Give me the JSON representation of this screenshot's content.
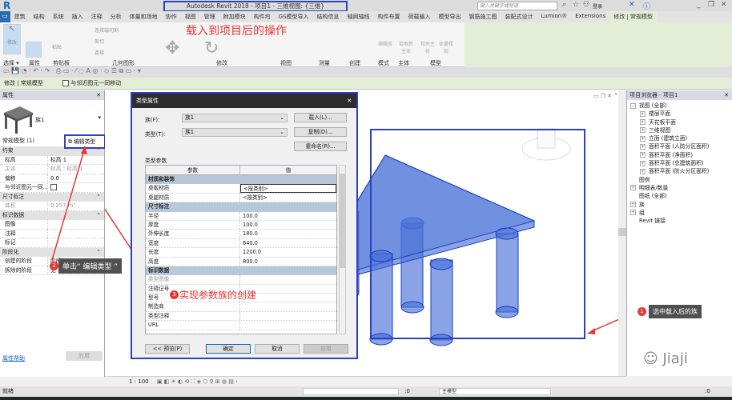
{
  "window": {
    "title": "Autodesk Revit 2018 -    项目1 - 三维视图: {三维}",
    "search_placeholder": "键入关键字或短语",
    "login": "登录"
  },
  "tabs": [
    "建筑",
    "结构",
    "系统",
    "插入",
    "注释",
    "分析",
    "体量和场地",
    "协作",
    "视图",
    "管理",
    "附加模块",
    "构件坞",
    "GS模型导入",
    "结构信息",
    "轴网轴线",
    "构件布置",
    "荷载输入",
    "模型导出",
    "钢筋施工图",
    "装配式设计",
    "Lumion®",
    "Extensions",
    "修改 | 常规模型"
  ],
  "active_tab": "修改 | 常规模型",
  "ribbon": {
    "modify_label": "修改",
    "paste_label": "粘贴",
    "join_label": "连接端切割",
    "cut_label": "剪切",
    "connect_label": "连接",
    "panels": [
      "选择 ▾",
      "属性",
      "剪贴板",
      "几何图形",
      "修改",
      "视图",
      "测量",
      "创建",
      "模式",
      "主体",
      "模型"
    ],
    "edit_family": "编辑族",
    "pick_host": "拾取新主体",
    "related_host": "相关主体",
    "mass_floors": "体量楼层"
  },
  "annotation_top": "载入到项目后的操作",
  "options_bar": {
    "context": "修改 | 常规模型",
    "checkbox_label": "与邻近图元一同移动",
    "checked": false
  },
  "properties": {
    "header": "属性",
    "family_name": "族1",
    "type_selector": "常规模型 (1)",
    "edit_type": "编辑类型",
    "groups": [
      {
        "name": "约束",
        "rows": [
          {
            "k": "标高",
            "v": "标高 1"
          },
          {
            "k": "主体",
            "v": "标高 : 标高 1",
            "disabled": true
          },
          {
            "k": "偏移",
            "v": "0.0"
          },
          {
            "k": "与邻近图元一同...",
            "v": "",
            "checkbox": true
          }
        ]
      },
      {
        "name": "尺寸标注",
        "rows": [
          {
            "k": "体积",
            "v": "0.257 m³",
            "disabled": true
          }
        ]
      },
      {
        "name": "标识数据",
        "rows": [
          {
            "k": "图像",
            "v": ""
          },
          {
            "k": "注释",
            "v": ""
          },
          {
            "k": "标记",
            "v": ""
          }
        ]
      },
      {
        "name": "阶段化",
        "rows": [
          {
            "k": "创建的阶段",
            "v": "阶段 1"
          },
          {
            "k": "拆除的阶段",
            "v": "无"
          }
        ]
      }
    ],
    "help_link": "属性帮助",
    "apply": "应用"
  },
  "callouts": {
    "c1": {
      "num": "1",
      "text": "选中载入后的族"
    },
    "c2": {
      "num": "2",
      "text": "单击“ 编辑类型 ”"
    },
    "c3": {
      "num": "3",
      "text": "实现参数族的创建"
    }
  },
  "dialog": {
    "title": "类型属性",
    "family_label": "族(F):",
    "family_value": "族1",
    "type_label": "类型(T):",
    "type_value": "族1",
    "load": "载入(L)...",
    "duplicate": "复制(D)...",
    "rename": "重命名(R)...",
    "type_params": "类型参数",
    "col_param": "参数",
    "col_value": "值",
    "groups": [
      {
        "name": "材质和装饰",
        "rows": [
          {
            "k": "桌板材质",
            "v": "<按类别>"
          },
          {
            "k": "桌腿材质",
            "v": "<按类别>"
          }
        ]
      },
      {
        "name": "尺寸标注",
        "rows": [
          {
            "k": "半径",
            "v": "100.0"
          },
          {
            "k": "厚度",
            "v": "100.0"
          },
          {
            "k": "外伸长度",
            "v": "180.0"
          },
          {
            "k": "宽度",
            "v": "640.0"
          },
          {
            "k": "长度",
            "v": "1200.0"
          },
          {
            "k": "高度",
            "v": "800.0"
          }
        ]
      },
      {
        "name": "标识数据",
        "rows": [
          {
            "k": "类型图像",
            "v": "",
            "disabled": true
          },
          {
            "k": "注释记号",
            "v": ""
          },
          {
            "k": "型号",
            "v": ""
          },
          {
            "k": "制造商",
            "v": ""
          },
          {
            "k": "类型注释",
            "v": ""
          },
          {
            "k": "URL",
            "v": ""
          }
        ]
      }
    ],
    "preview": "<< 预览(P)",
    "ok": "确定",
    "cancel": "取消",
    "apply": "应用"
  },
  "browser": {
    "header": "项目浏览器 - 项目1",
    "items": [
      {
        "label": "视图 (全部)",
        "level": 0,
        "exp": "−"
      },
      {
        "label": "楼层平面",
        "level": 1,
        "exp": "+"
      },
      {
        "label": "天花板平面",
        "level": 1,
        "exp": "+"
      },
      {
        "label": "三维视图",
        "level": 1,
        "exp": "+"
      },
      {
        "label": "立面 (建筑立面)",
        "level": 1,
        "exp": "+"
      },
      {
        "label": "面积平面 (人防分区面积)",
        "level": 1,
        "exp": "+"
      },
      {
        "label": "面积平面 (净面积)",
        "level": 1,
        "exp": "+"
      },
      {
        "label": "面积平面 (总建筑面积)",
        "level": 1,
        "exp": "+"
      },
      {
        "label": "面积平面 (防火分区面积)",
        "level": 1,
        "exp": "+"
      },
      {
        "label": "图例",
        "level": 0,
        "exp": ""
      },
      {
        "label": "明细表/数量",
        "level": 0,
        "exp": "+"
      },
      {
        "label": "图纸 (全部)",
        "level": 0,
        "exp": ""
      },
      {
        "label": "族",
        "level": 0,
        "exp": "+"
      },
      {
        "label": "组",
        "level": 0,
        "exp": "+"
      },
      {
        "label": "Revit 链接",
        "level": 0,
        "exp": ""
      }
    ]
  },
  "view_controls": {
    "scale": "1 : 100"
  },
  "statusbar": {
    "text": "就绪",
    "workset_value": ":0",
    "model": "主模型",
    "filter": ":0"
  },
  "watermark": "Jiaji",
  "colors": {
    "selection": "#2b3fc7",
    "annotation": "#e53935",
    "model_fill": "#4a72d8",
    "ribbon_context": "#e4eed6"
  }
}
